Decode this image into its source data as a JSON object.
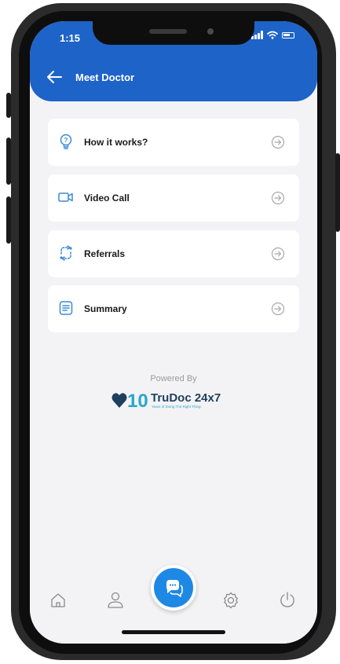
{
  "status_bar": {
    "time": "1:15"
  },
  "header": {
    "title": "Meet Doctor"
  },
  "menu": [
    {
      "label": "How it works?",
      "icon": "lightbulb-icon"
    },
    {
      "label": "Video Call",
      "icon": "video-camera-icon"
    },
    {
      "label": "Referrals",
      "icon": "referral-icon"
    },
    {
      "label": "Summary",
      "icon": "document-icon"
    }
  ],
  "branding": {
    "powered_by": "Powered By",
    "logo_number": "10",
    "logo_name": "TruDoc 24x7",
    "logo_tagline": "Years of Doing The Right Thing."
  },
  "tabbar": {
    "items": [
      "home-icon",
      "profile-icon",
      "chat-icon",
      "settings-icon",
      "power-icon"
    ]
  },
  "colors": {
    "primary": "#1e63c8",
    "fab": "#1e88e5",
    "background": "#f3f3f5",
    "logo_dark": "#1f3f5f",
    "logo_teal": "#2aa7c9"
  }
}
